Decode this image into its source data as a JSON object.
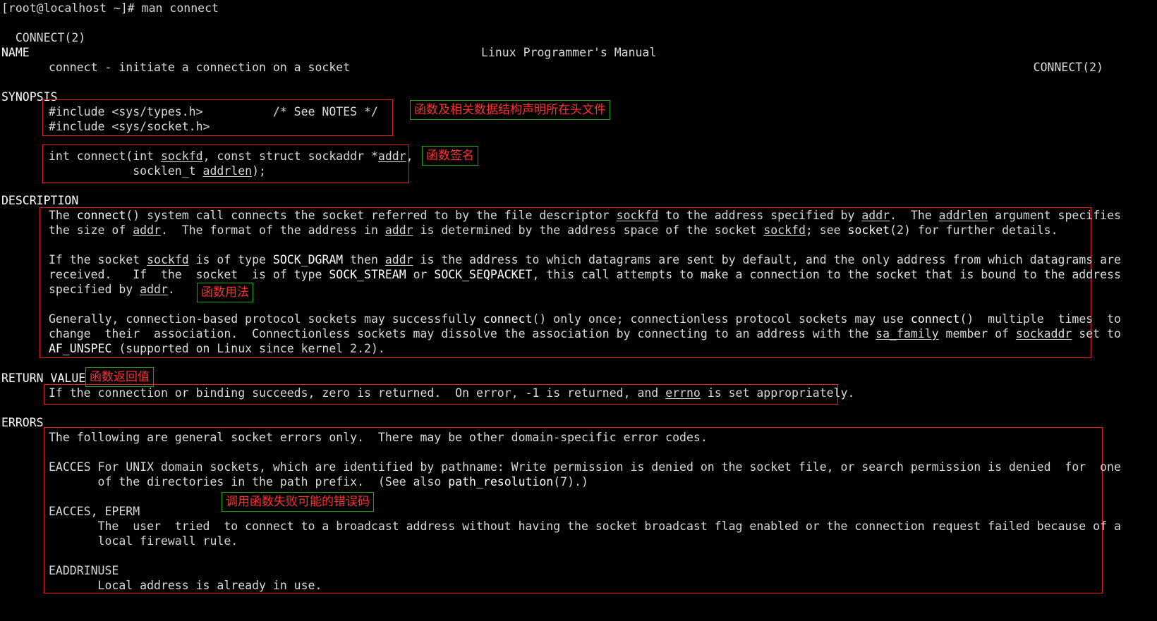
{
  "terminal": {
    "prompt": "[root@localhost ~]# ",
    "command": "man connect",
    "header_left": "CONNECT(2)",
    "header_center": "Linux Programmer's Manual",
    "header_right": "CONNECT(2)"
  },
  "sections": {
    "name": {
      "heading": "NAME",
      "text": "connect - initiate a connection on a socket"
    },
    "synopsis": {
      "heading": "SYNOPSIS",
      "include1": "#include <sys/types.h>          /* See NOTES */",
      "include2": "#include <sys/socket.h>",
      "sig_a": "int connect(int ",
      "sig_sockfd": "sockfd",
      "sig_b": ", const struct sockaddr *",
      "sig_addr": "addr",
      "sig_c": ",",
      "sig2_a": "            socklen_t ",
      "sig2_addrlen": "addrlen",
      "sig2_b": ");"
    },
    "description": {
      "heading": "DESCRIPTION",
      "p1l1": [
        "The ",
        "connect",
        "() system call connects the socket referred to by the file descriptor ",
        "sockfd",
        " to the address specified by ",
        "addr",
        ".  The ",
        "addrlen",
        " argument specifies"
      ],
      "p1l2": [
        "the size of ",
        "addr",
        ".  The format of the address in ",
        "addr",
        " is determined by the address space of the socket ",
        "sockfd",
        "; see ",
        "socket",
        "(2) for further details."
      ],
      "p2l1": [
        "If the socket ",
        "sockfd",
        " is of type ",
        "SOCK_DGRAM",
        " then ",
        "addr",
        " is the address to which datagrams are sent by default, and the only address from which datagrams are"
      ],
      "p2l2": [
        "received.   If  the  socket  is of type ",
        "SOCK_STREAM",
        " or ",
        "SOCK_SEQPACKET",
        ", this call attempts to make a connection to the socket that is bound to the address"
      ],
      "p2l3": [
        "specified by ",
        "addr",
        "."
      ],
      "p3l1": [
        "Generally, connection-based protocol sockets may successfully ",
        "connect",
        "() only once; connectionless protocol sockets may use ",
        "connect",
        "()  multiple  times  to"
      ],
      "p3l2": [
        "change  their  association.  Connectionless sockets may dissolve the association by connecting to an address with the ",
        "sa_family",
        " member of ",
        "sockaddr",
        " set to"
      ],
      "p3l3": [
        "AF_UNSPEC",
        " (supported on Linux since kernel 2.2)."
      ]
    },
    "return_value": {
      "heading": "RETURN VALUE",
      "line": [
        "If the connection or binding succeeds, zero is returned.  On error, -1 is returned, and ",
        "errno",
        " is set appropriately."
      ]
    },
    "errors": {
      "heading": "ERRORS",
      "intro": "The following are general socket errors only.  There may be other domain-specific error codes.",
      "eacces_l1": "EACCES For UNIX domain sockets, which are identified by pathname: Write permission is denied on the socket file, or search permission is denied  for  one",
      "eacces_l2": [
        "       of the directories in the path prefix.  (See also ",
        "path_resolution",
        "(7).)"
      ],
      "eperm_term": "EACCES, EPERM",
      "eperm_l1": "       The  user  tried  to connect to a broadcast address without having the socket broadcast flag enabled or the connection request failed because of a",
      "eperm_l2": "       local firewall rule.",
      "eaddrinuse_term": "EADDRINUSE",
      "eaddrinuse_l1": "       Local address is already in use."
    }
  },
  "annotations": {
    "headers": "函数及相关数据结构声明所在头文件",
    "signature": "函数签名",
    "usage": "函数用法",
    "return": "函数返回值",
    "errors": "调用函数失败可能的错误码"
  },
  "colors": {
    "box_border": "#e02020",
    "note_border": "#1fa31f",
    "note_text": "#ff3030"
  }
}
